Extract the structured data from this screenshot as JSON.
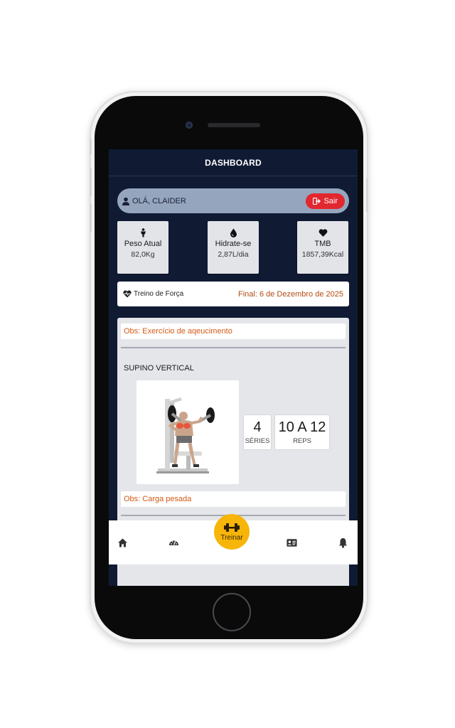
{
  "header": {
    "title": "DASHBOARD"
  },
  "greeting": {
    "text": "OLÁ, CLAIDER",
    "logout_label": "Sair"
  },
  "stats": [
    {
      "icon": "person-icon",
      "label": "Peso Atual",
      "value": "82,0Kg"
    },
    {
      "icon": "water-drop-icon",
      "label": "Hidrate-se",
      "value": "2,87L/dia"
    },
    {
      "icon": "heart-icon",
      "label": "TMB",
      "value": "1857,39Kcal"
    }
  ],
  "workout": {
    "icon": "heartbeat-icon",
    "name": "Treino de Força",
    "end_date": "Final: 6 de Dezembro de 2025"
  },
  "exercise_panel": {
    "obs_top": "Obs: Exercício de aqeucimento",
    "exercise": {
      "name": "SUPINO VERTICAL",
      "series_value": "4",
      "series_label": "SÉRIES",
      "reps_value": "10 A 12",
      "reps_label": "REPS",
      "obs": "Obs: Carga pesada"
    }
  },
  "bottom_nav": {
    "items": [
      {
        "icon": "home-icon"
      },
      {
        "icon": "gauge-icon"
      },
      {
        "icon": "dumbbell-icon",
        "label": "Treinar",
        "active": true
      },
      {
        "icon": "id-card-icon"
      },
      {
        "icon": "bell-icon"
      }
    ]
  },
  "colors": {
    "background": "#101a33",
    "accent": "#f7b50a",
    "logout": "#e2272f",
    "obs_text": "#d25a14"
  }
}
